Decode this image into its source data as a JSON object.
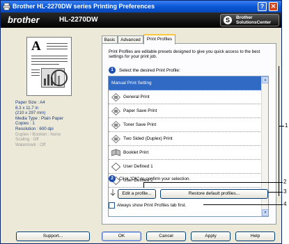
{
  "window": {
    "title": "Brother HL-2270DW series Printing Preferences",
    "help_glyph": "?",
    "close_glyph": "✕"
  },
  "brand": {
    "logo": "brother",
    "model": "HL-2270DW",
    "solutions_center_line1": "Brother",
    "solutions_center_line2": "SolutionsCenter",
    "solutions_center_icon": "S"
  },
  "preview": {
    "big_letter": "A"
  },
  "info": [
    {
      "text": "Paper Size : A4",
      "enabled": true
    },
    {
      "text": "8.3 x 11.7 in",
      "enabled": true
    },
    {
      "text": "(210 x 297 mm)",
      "enabled": true
    },
    {
      "text": "Media Type : Plain Paper",
      "enabled": true
    },
    {
      "text": "Copies : 1",
      "enabled": true
    },
    {
      "text": "Resolution : 600 dpi",
      "enabled": true
    },
    {
      "text": "Duplex / Booklet : None",
      "enabled": false
    },
    {
      "text": "Scaling : Off",
      "enabled": false
    },
    {
      "text": "Watermark : Off",
      "enabled": false
    }
  ],
  "support_button": "Support...",
  "tabs": [
    {
      "label": "Basic",
      "active": false
    },
    {
      "label": "Advanced",
      "active": false
    },
    {
      "label": "Print Profiles",
      "active": true
    }
  ],
  "panel": {
    "intro": "Print Profiles are editable presets designed to give you quick access to the best settings for your print job.",
    "step1_num": "1",
    "step1_label": "Select the desired Print Profile:",
    "step2_num": "2",
    "step2_label": "Click \"OK\" to confirm your selection.",
    "edit_profile_button": "Edit a profile...",
    "restore_defaults_button": "Restore default profiles...",
    "always_show_label": "Always show Print Profiles tab first.",
    "always_show_checked": false
  },
  "profiles": [
    {
      "label": "Manual Print Setting",
      "icon": "none",
      "selected": true
    },
    {
      "label": "General Print",
      "icon": "diamond-printer-icon",
      "selected": false
    },
    {
      "label": "Paper Save Print",
      "icon": "diamond-printer-icon",
      "selected": false
    },
    {
      "label": "Toner Save Print",
      "icon": "diamond-printer-icon",
      "selected": false
    },
    {
      "label": "Two Sided (Duplex) Print",
      "icon": "diamond-printer-icon",
      "selected": false
    },
    {
      "label": "Booklet Print",
      "icon": "booklet-icon",
      "selected": false
    },
    {
      "label": "User Defined 1",
      "icon": "diamond-outline-icon",
      "selected": false
    },
    {
      "label": "User Defined 2",
      "icon": "diamond-outline-icon",
      "selected": false
    }
  ],
  "footer": {
    "ok": "OK",
    "cancel": "Cancel",
    "apply": "Apply",
    "help": "Help"
  },
  "callouts": [
    "1",
    "2",
    "3",
    "4"
  ],
  "colors": {
    "titlebar": "#0a57d6",
    "selection": "#316ac5",
    "step_badge": "#1f4fae",
    "active_tab_accent": "#ffc73c"
  }
}
